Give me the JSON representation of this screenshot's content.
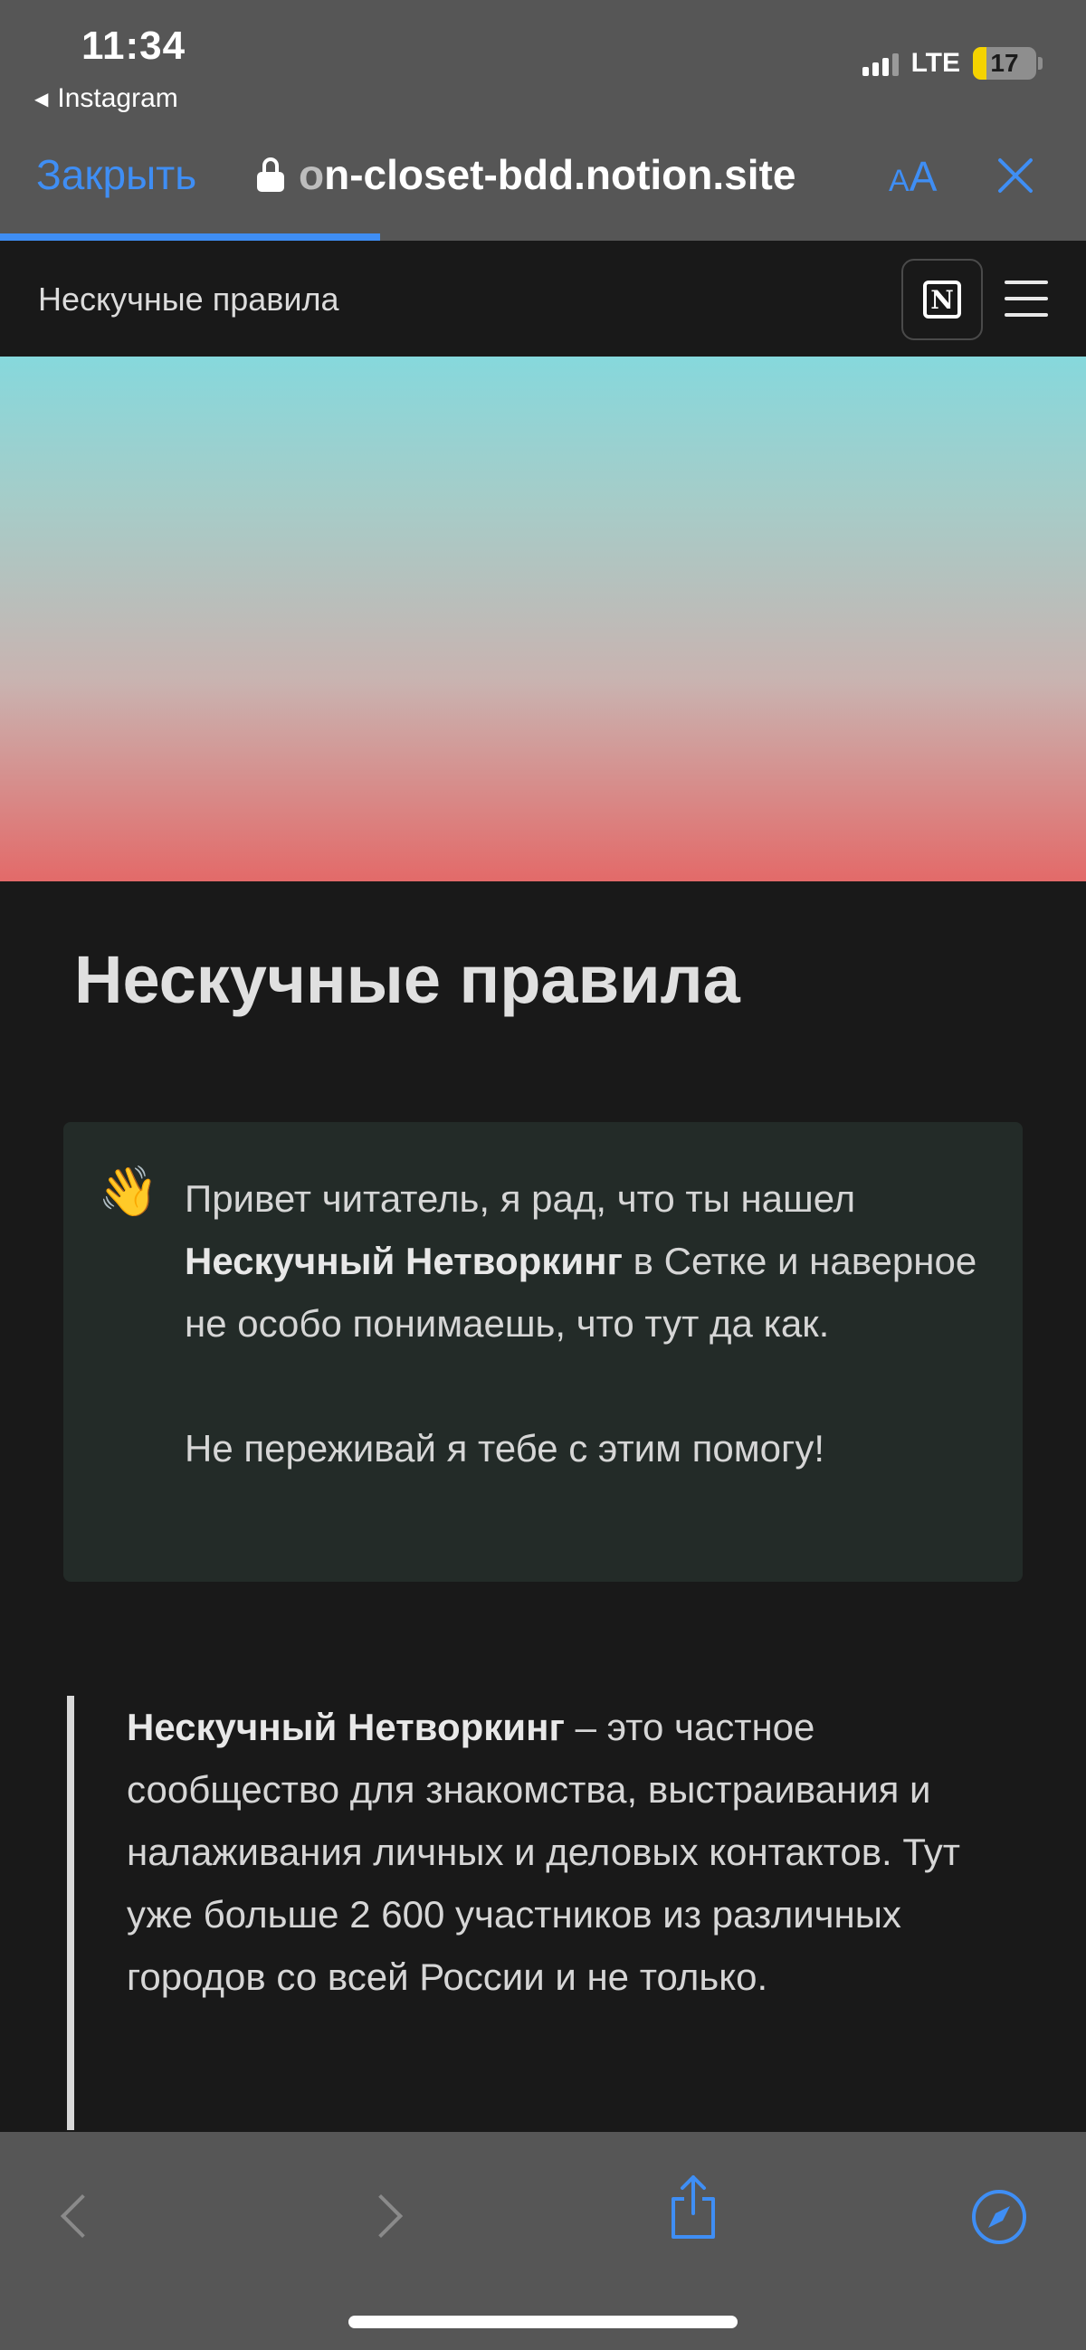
{
  "status_bar": {
    "time": "11:34",
    "back_app": "Instagram",
    "network": "LTE",
    "battery": "17"
  },
  "browser": {
    "close_label": "Закрыть",
    "url_faded": "o",
    "url_main": "n-closet-bdd.notion.site",
    "reader_small": "A",
    "reader_big": "A"
  },
  "notion_header": {
    "title": "Нескучные правила",
    "logo_letter": "N"
  },
  "page": {
    "title": "Нескучные правила",
    "callout": {
      "icon": "👋",
      "line1_pre": "Привет читатель, я рад, что ты нашел ",
      "line1_bold": "Нескучный Нетворкинг",
      "line1_post": " в Сетке и наверное не особо понимаешь, что тут да как.",
      "line2": "Не переживай я тебе с этим помогу!"
    },
    "quote": {
      "bold": "Нескучный Нетворкинг",
      "text": " – это частное сообщество для знакомства, выстраивания и налаживания личных и деловых контактов. Тут уже больше 2 600 участников из различных городов со всей России и не только."
    }
  },
  "colors": {
    "accent": "#3f8ef4",
    "background": "#191919",
    "chrome": "#565656",
    "callout_bg": "#232b28"
  }
}
